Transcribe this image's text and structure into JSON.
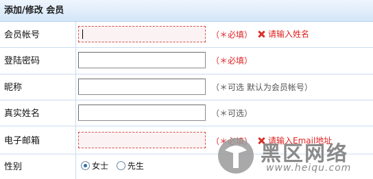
{
  "header": {
    "title": "添加/修改 会员"
  },
  "fields": [
    {
      "label": "会员帐号",
      "hint": "（＊必填）",
      "error": "请输入姓名"
    },
    {
      "label": "登陆密码",
      "hint": "（＊必填）"
    },
    {
      "label": "昵称",
      "hint": "（＊可选  默认为会员帐号）"
    },
    {
      "label": "真实姓名",
      "hint": "（＊可选）"
    },
    {
      "label": "电子邮箱",
      "hint": "（＊必填）",
      "error": "请输入Email地址"
    }
  ],
  "gender": {
    "label": "性别",
    "options": [
      "女士",
      "先生"
    ],
    "selected": "女士"
  },
  "watermark": {
    "title": "黑区网络",
    "url": "www.heiqu.com"
  },
  "colors": {
    "error": "#e02020",
    "border": "#c9dcef",
    "header_bg": "#d4e6f8"
  }
}
